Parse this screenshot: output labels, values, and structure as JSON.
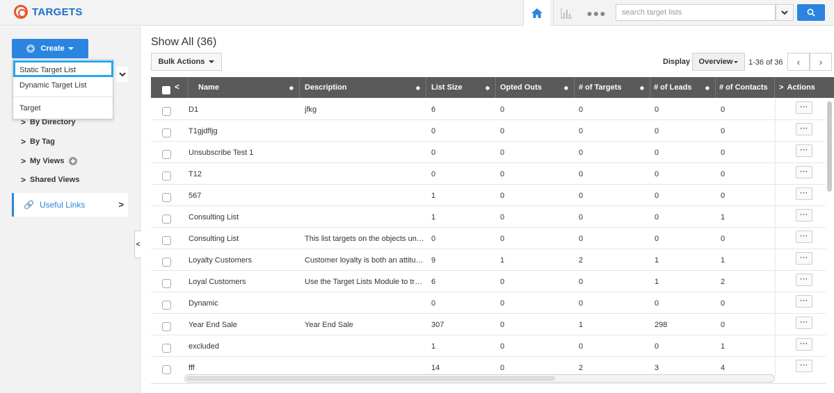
{
  "app": {
    "title": "TARGETS",
    "brand_color": "#1b6fc9",
    "accent_color": "#2b85e0"
  },
  "header": {
    "icons": [
      "home-icon",
      "chart-icon",
      "more-icon"
    ],
    "search": {
      "placeholder": "search target lists"
    }
  },
  "sidebar": {
    "create_label": "Create",
    "items": [
      {
        "label": "By Directory"
      },
      {
        "label": "By Tag"
      },
      {
        "label": "My Views"
      },
      {
        "label": "Shared Views"
      }
    ],
    "useful_links": "Useful Links"
  },
  "create_menu": {
    "items": [
      "Static Target List",
      "Dynamic Target List",
      "Target"
    ],
    "highlighted": "Static Target List"
  },
  "main": {
    "title": "Show All (36)",
    "bulk_actions": "Bulk Actions",
    "display_label": "Display",
    "display_value": "Overview",
    "paging": "1-36 of 36"
  },
  "table": {
    "columns": [
      "Name",
      "Description",
      "List Size",
      "Opted Outs",
      "# of Targets",
      "# of Leads",
      "# of Contacts",
      "Actions"
    ],
    "actions_glyph": "···",
    "rows": [
      {
        "name": "D1",
        "description": "jfkg",
        "list_size": "6",
        "opted_outs": "0",
        "targets": "0",
        "leads": "0",
        "contacts": "0"
      },
      {
        "name": "T1gjdfljg",
        "description": "",
        "list_size": "0",
        "opted_outs": "0",
        "targets": "0",
        "leads": "0",
        "contacts": "0"
      },
      {
        "name": "Unsubscribe Test 1",
        "description": "",
        "list_size": "0",
        "opted_outs": "0",
        "targets": "0",
        "leads": "0",
        "contacts": "0"
      },
      {
        "name": "T12",
        "description": "",
        "list_size": "0",
        "opted_outs": "0",
        "targets": "0",
        "leads": "0",
        "contacts": "0"
      },
      {
        "name": "567",
        "description": "",
        "list_size": "1",
        "opted_outs": "0",
        "targets": "0",
        "leads": "0",
        "contacts": "0"
      },
      {
        "name": "Consulting List",
        "description": "",
        "list_size": "1",
        "opted_outs": "0",
        "targets": "0",
        "leads": "0",
        "contacts": "1"
      },
      {
        "name": "Consulting List",
        "description": "This list targets on the objects un…",
        "list_size": "0",
        "opted_outs": "0",
        "targets": "0",
        "leads": "0",
        "contacts": "0"
      },
      {
        "name": "Loyalty Customers",
        "description": "Customer loyalty is both an attitu…",
        "list_size": "9",
        "opted_outs": "1",
        "targets": "2",
        "leads": "1",
        "contacts": "1"
      },
      {
        "name": "Loyal Customers",
        "description": "Use the Target Lists Module to tr…",
        "list_size": "6",
        "opted_outs": "0",
        "targets": "0",
        "leads": "1",
        "contacts": "2"
      },
      {
        "name": "Dynamic",
        "description": "",
        "list_size": "0",
        "opted_outs": "0",
        "targets": "0",
        "leads": "0",
        "contacts": "0"
      },
      {
        "name": "Year End Sale",
        "description": "Year End Sale",
        "list_size": "307",
        "opted_outs": "0",
        "targets": "1",
        "leads": "298",
        "contacts": "0"
      },
      {
        "name": "excluded",
        "description": "",
        "list_size": "1",
        "opted_outs": "0",
        "targets": "0",
        "leads": "0",
        "contacts": "1"
      },
      {
        "name": "fff",
        "description": "",
        "list_size": "14",
        "opted_outs": "0",
        "targets": "2",
        "leads": "3",
        "contacts": "4"
      }
    ]
  }
}
